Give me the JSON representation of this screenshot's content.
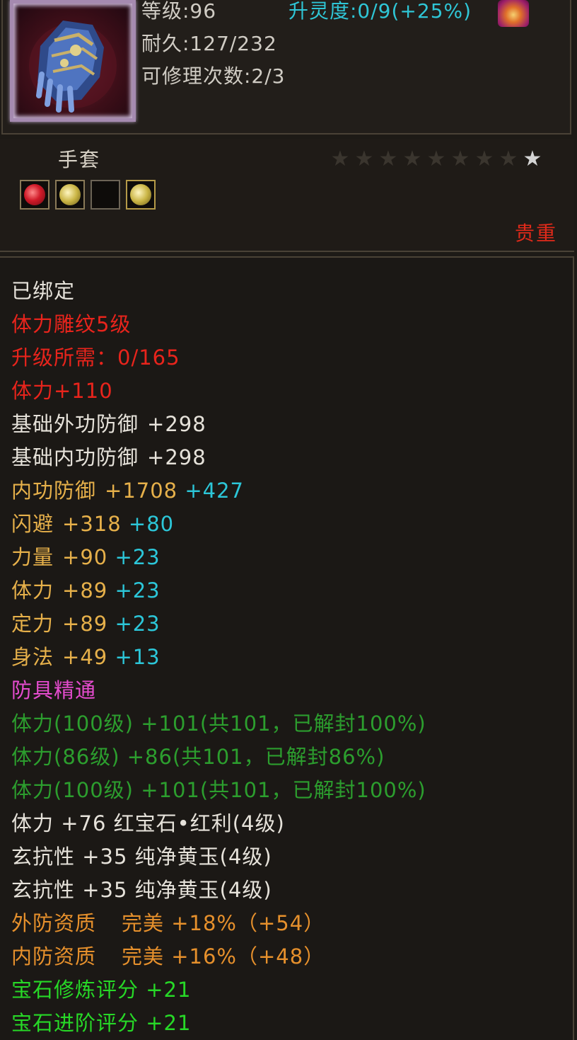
{
  "header": {
    "level_text": "等级:96",
    "spirit_label": "升灵度:0/9",
    "spirit_bonus": "(+25%)",
    "durability_text": "耐久:127/232",
    "repair_text": "可修理次数:2/3"
  },
  "item": {
    "type_name": "手套",
    "rarity_text": "贵重",
    "star_total": 9,
    "star_lit": 1
  },
  "attributes": {
    "bound": "已绑定",
    "engrave": "体力雕纹5级",
    "upgrade_need": "升级所需：0/165",
    "engrave_stat": "体力+110",
    "base_ext_def_label": "基础外功防御",
    "base_ext_def_value": "+298",
    "base_int_def_label": "基础内功防御",
    "base_int_def_value": "+298",
    "int_def_label": "内功防御",
    "int_def_value": "+1708",
    "int_def_bonus": "+427",
    "dodge_label": "闪避",
    "dodge_value": "+318",
    "dodge_bonus": "+80",
    "str_label": "力量",
    "str_value": "+90",
    "str_bonus": "+23",
    "vit_label": "体力",
    "vit_value": "+89",
    "vit_bonus": "+23",
    "foc_label": "定力",
    "foc_value": "+89",
    "foc_bonus": "+23",
    "agi_label": "身法",
    "agi_value": "+49",
    "agi_bonus": "+13",
    "mastery": "防具精通",
    "mastery_1": "体力(100级) +101(共101，已解封100%)",
    "mastery_2": "体力(86级) +86(共101，已解封86%)",
    "mastery_3": "体力(100级) +101(共101，已解封100%)",
    "gem_1": "体力 +76 红宝石•红利(4级)",
    "gem_2": "玄抗性 +35 纯净黄玉(4级)",
    "gem_3": "玄抗性 +35 纯净黄玉(4级)",
    "ext_quality_label": "外防资质",
    "ext_quality_value": "完美 +18%（+54）",
    "int_quality_label": "内防资质",
    "int_quality_value": "完美 +16%（+48）",
    "gem_refine_score": "宝石修炼评分 +21",
    "gem_advance_score": "宝石进阶评分 +21"
  },
  "colors": {
    "rarity": "#e02a1a",
    "cyan": "#2cc6d8",
    "gold": "#e6b04a",
    "pink": "#e64ccf",
    "green": "#2c9e2e",
    "lime": "#27d827",
    "orange": "#e6902c"
  },
  "icons": {
    "portrait": "gauntlet-icon",
    "spirit": "flame-spirit-icon",
    "gems": [
      "red-gem-icon",
      "yellow-gem-icon",
      "empty-slot",
      "yellow-gem-icon"
    ]
  }
}
